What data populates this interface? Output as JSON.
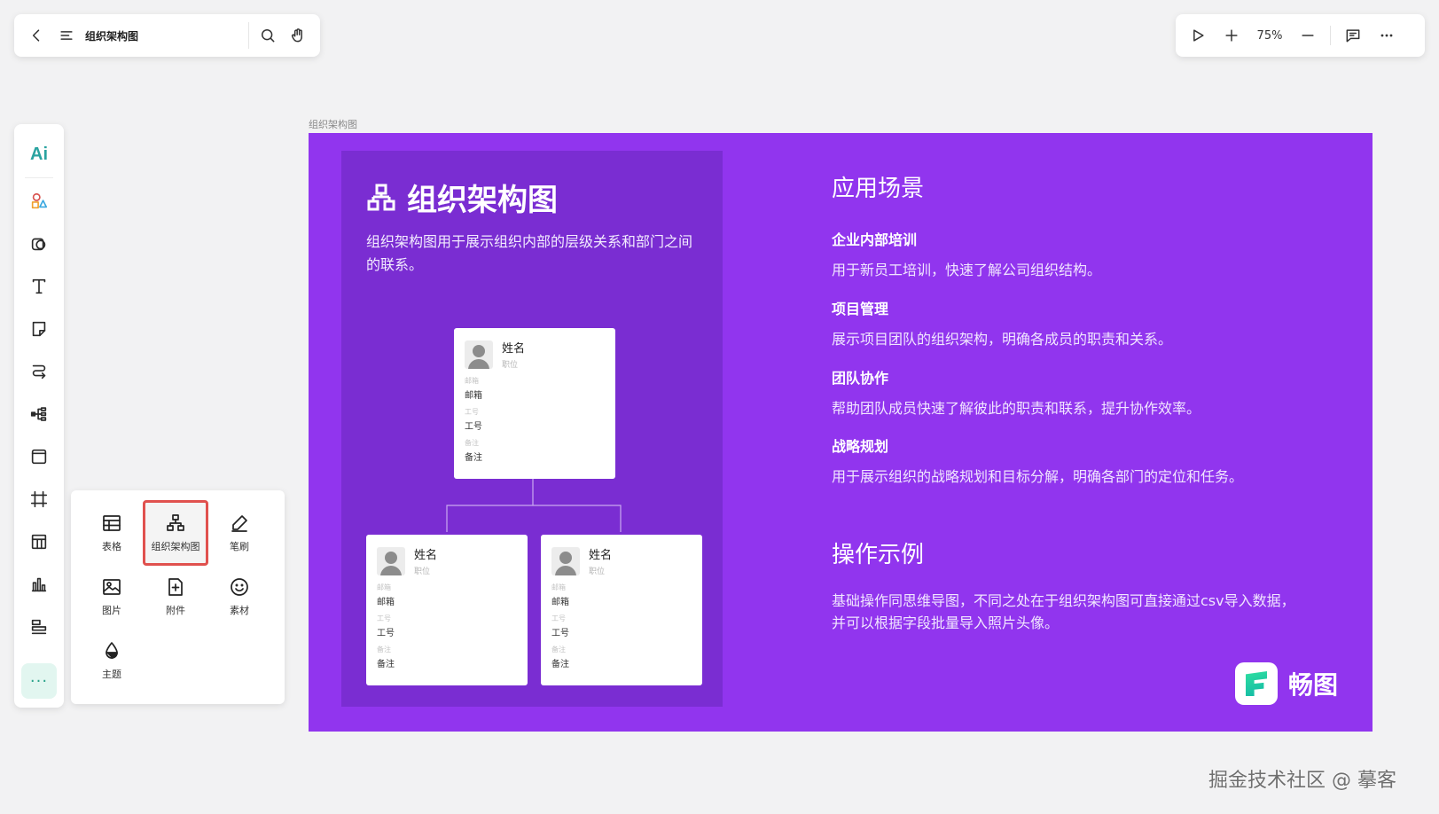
{
  "topbar": {
    "doc_title": "组织架构图",
    "zoom": "75%"
  },
  "tool_panel": {
    "items": [
      {
        "label": "表格",
        "icon": "table-icon"
      },
      {
        "label": "组织架构图",
        "icon": "org-chart-icon",
        "selected": true
      },
      {
        "label": "笔刷",
        "icon": "brush-icon"
      },
      {
        "label": "图片",
        "icon": "image-icon"
      },
      {
        "label": "附件",
        "icon": "attachment-icon"
      },
      {
        "label": "素材",
        "icon": "smiley-icon"
      },
      {
        "label": "主题",
        "icon": "theme-drop-icon"
      }
    ]
  },
  "rail": {
    "ai_label": "Ai"
  },
  "canvas": {
    "frame_label": "组织架构图",
    "colors": {
      "frame_bg": "#9135ee",
      "panel_bg": "#7a2dd2",
      "highlight": "#e0514e"
    },
    "left": {
      "heading": "组织架构图",
      "description": "组织架构图用于展示组织内部的层级关系和部门之间的联系。",
      "card": {
        "name": "姓名",
        "role": "职位",
        "email_key": "邮箱",
        "email_val": "邮箱",
        "id_key": "工号",
        "id_val": "工号",
        "note_key": "备注",
        "note_val": "备注"
      }
    },
    "right": {
      "scenes_title": "应用场景",
      "scenes": [
        {
          "title": "企业内部培训",
          "text": "用于新员工培训，快速了解公司组织结构。"
        },
        {
          "title": "项目管理",
          "text": "展示项目团队的组织架构，明确各成员的职责和关系。"
        },
        {
          "title": "团队协作",
          "text": "帮助团队成员快速了解彼此的职责和联系，提升协作效率。"
        },
        {
          "title": "战略规划",
          "text": "用于展示组织的战略规划和目标分解，明确各部门的定位和任务。"
        }
      ],
      "example_title": "操作示例",
      "example_text": "基础操作同思维导图，不同之处在于组织架构图可直接通过csv导入数据，并可以根据字段批量导入照片头像。"
    },
    "brand_name": "畅图"
  },
  "watermark": "掘金技术社区 @ 摹客"
}
